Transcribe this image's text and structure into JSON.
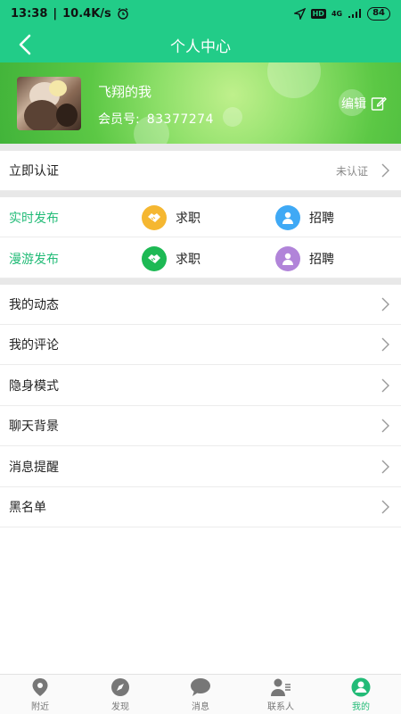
{
  "status": {
    "time": "13:38",
    "speed": "10.4K/s",
    "network": "4G",
    "hd": "HD",
    "battery": "84"
  },
  "header": {
    "title": "个人中心"
  },
  "profile": {
    "name": "飞翔的我",
    "member_label": "会员号:",
    "member_id": "83377274",
    "edit_label": "编辑"
  },
  "verify": {
    "label": "立即认证",
    "status": "未认证"
  },
  "publish": [
    {
      "label": "实时发布",
      "job_seek": "求职",
      "recruit": "招聘",
      "seek_color": "#f5b731",
      "recruit_color": "#3fa9f5"
    },
    {
      "label": "漫游发布",
      "job_seek": "求职",
      "recruit": "招聘",
      "seek_color": "#1db954",
      "recruit_color": "#b184d9"
    }
  ],
  "menu": [
    {
      "label": "我的动态"
    },
    {
      "label": "我的评论"
    },
    {
      "label": "隐身模式"
    },
    {
      "label": "聊天背景"
    },
    {
      "label": "消息提醒"
    },
    {
      "label": "黑名单"
    }
  ],
  "tabs": [
    {
      "label": "附近",
      "icon": "location-pin-icon"
    },
    {
      "label": "发现",
      "icon": "compass-icon"
    },
    {
      "label": "消息",
      "icon": "chat-bubble-icon"
    },
    {
      "label": "联系人",
      "icon": "contacts-icon"
    },
    {
      "label": "我的",
      "icon": "person-icon",
      "active": true
    }
  ],
  "colors": {
    "primary": "#22cc88",
    "accent_text": "#22bb77",
    "divider": "#e8e8e8"
  }
}
